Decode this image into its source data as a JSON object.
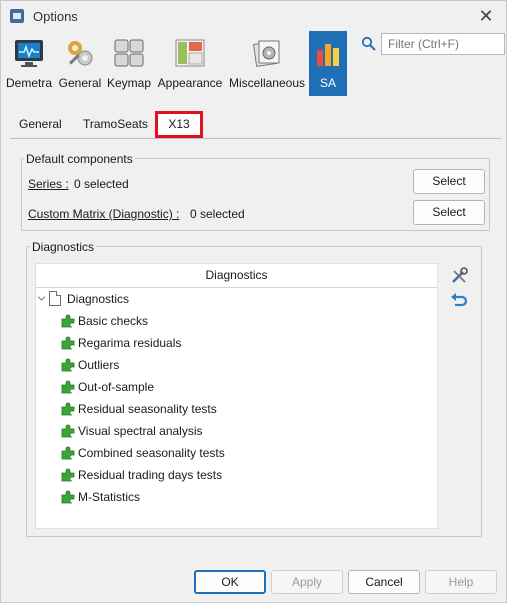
{
  "window": {
    "title": "Options",
    "close_icon": "close-icon",
    "app_icon": "app-icon"
  },
  "categories": [
    {
      "label": "Demetra",
      "icon": "monitor-icon"
    },
    {
      "label": "General",
      "icon": "gears-icon"
    },
    {
      "label": "Keymap",
      "icon": "keyboard-icon"
    },
    {
      "label": "Appearance",
      "icon": "layout-icon"
    },
    {
      "label": "Miscellaneous",
      "icon": "misc-icon"
    },
    {
      "label": "SA",
      "icon": "bar-chart-icon",
      "selected": true
    }
  ],
  "search": {
    "placeholder": "Filter (Ctrl+F)",
    "value": ""
  },
  "tabs": {
    "general": "General",
    "tramoseats": "TramoSeats",
    "x13": "X13",
    "active": "X13"
  },
  "default_components": {
    "title": "Default components",
    "series_label": "Series :",
    "series_value": "0 selected",
    "series_button": "Select",
    "matrix_label": "Custom Matrix (Diagnostic) :",
    "matrix_value": "0 selected",
    "matrix_button": "Select"
  },
  "diagnostics": {
    "group_title": "Diagnostics",
    "column_header": "Diagnostics",
    "root_label": "Diagnostics",
    "items": [
      "Basic checks",
      "Regarima residuals",
      "Outliers",
      "Out-of-sample",
      "Residual seasonality tests",
      "Visual spectral analysis",
      "Combined seasonality tests",
      "Residual trading days tests",
      "M-Statistics"
    ],
    "side_icons": [
      "settings-tools-icon",
      "reset-undo-icon"
    ]
  },
  "footer": {
    "ok": "OK",
    "apply": "Apply",
    "cancel": "Cancel",
    "help": "Help"
  },
  "colors": {
    "accent": "#1f6fb7",
    "highlight_border": "#e01020",
    "plugin_green": "#3aa537"
  }
}
